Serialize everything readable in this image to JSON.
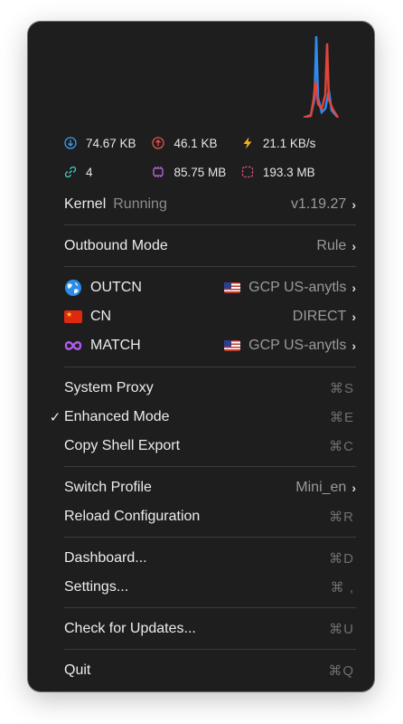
{
  "stats": {
    "download": "74.67 KB",
    "upload": "46.1 KB",
    "speed": "21.1 KB/s",
    "connections": "4",
    "memory": "85.75 MB",
    "total": "193.3 MB"
  },
  "kernel": {
    "label": "Kernel",
    "status": "Running",
    "version": "v1.19.27"
  },
  "outbound": {
    "label": "Outbound Mode",
    "value": "Rule"
  },
  "proxies": [
    {
      "name": "OUTCN",
      "value": "GCP US-anytls"
    },
    {
      "name": "CN",
      "value": "DIRECT"
    },
    {
      "name": "MATCH",
      "value": "GCP US-anytls"
    }
  ],
  "menu": {
    "system_proxy": {
      "label": "System Proxy",
      "shortcut": "⌘S"
    },
    "enhanced_mode": {
      "label": "Enhanced Mode",
      "shortcut": "⌘E",
      "check": "✓"
    },
    "copy_shell": {
      "label": "Copy Shell Export",
      "shortcut": "⌘C"
    },
    "switch_profile": {
      "label": "Switch Profile",
      "value": "Mini_en"
    },
    "reload": {
      "label": "Reload Configuration",
      "shortcut": "⌘R"
    },
    "dashboard": {
      "label": "Dashboard...",
      "shortcut": "⌘D"
    },
    "settings": {
      "label": "Settings...",
      "shortcut": "⌘ ,"
    },
    "updates": {
      "label": "Check for Updates...",
      "shortcut": "⌘U"
    },
    "quit": {
      "label": "Quit",
      "shortcut": "⌘Q"
    }
  },
  "icons": {
    "download": "arrow-down-circle-icon",
    "upload": "arrow-up-circle-icon",
    "speed": "lightning-icon",
    "connections": "link-icon",
    "memory": "chip-icon",
    "total": "dashed-square-icon"
  },
  "colors": {
    "download_graph": "#2d8cf0",
    "upload_graph": "#e0453a",
    "menu_bg": "#1e1e1e"
  }
}
